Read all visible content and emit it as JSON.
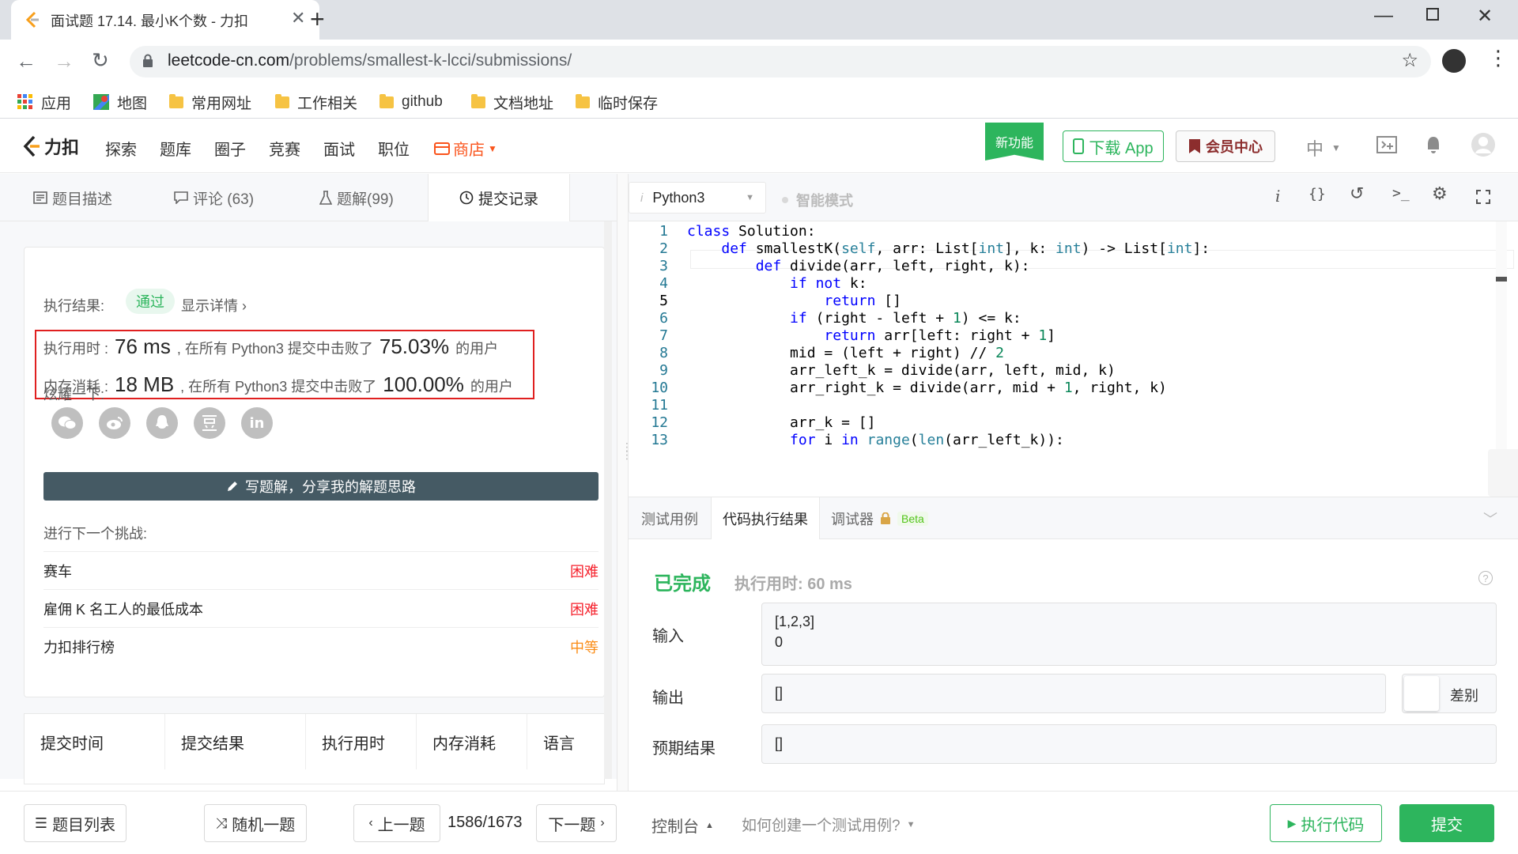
{
  "browser": {
    "tab_title": "面试题 17.14. 最小K个数 - 力扣",
    "url_host": "leetcode-cn.com",
    "url_path": "/problems/smallest-k-lcci/submissions/",
    "bookmarks": [
      "应用",
      "地图",
      "常用网址",
      "工作相关",
      "github",
      "文档地址",
      "临时保存"
    ]
  },
  "site": {
    "logo_text": "力扣",
    "nav": [
      "探索",
      "题库",
      "圈子",
      "竞赛",
      "面试",
      "职位"
    ],
    "store_label": "商店",
    "new_feature": "新功能",
    "download_app": "下载 App",
    "member_center": "会员中心",
    "lang": "中"
  },
  "left_tabs": [
    "题目描述",
    "评论 (63)",
    "题解(99)",
    "提交记录"
  ],
  "result": {
    "label": "执行结果:",
    "status": "通过",
    "details_link": "显示详情 ›",
    "time_label": "执行用时 :",
    "time_value": "76 ms",
    "time_text": ", 在所有 Python3 提交中击败了",
    "time_percent": "75.03%",
    "time_suffix": "的用户",
    "mem_label": "内存消耗 :",
    "mem_value": "18 MB",
    "mem_text": ", 在所有 Python3 提交中击败了",
    "mem_percent": "100.00%",
    "mem_suffix": "的用户",
    "share_label": "炫耀一下:",
    "share_icons": [
      "wechat-icon",
      "weibo-icon",
      "qq-icon",
      "douban-icon",
      "linkedin-icon"
    ],
    "write_solution": "写题解，分享我的解题思路",
    "next_label": "进行下一个挑战:",
    "challenges": [
      {
        "name": "赛车",
        "level": "困难"
      },
      {
        "name": "雇佣 K 名工人的最低成本",
        "level": "困难"
      },
      {
        "name": "力扣排行榜",
        "level": "中等"
      }
    ]
  },
  "submissions_table": {
    "headers": [
      "提交时间",
      "提交结果",
      "执行用时",
      "内存消耗",
      "语言"
    ]
  },
  "editor": {
    "language": "Python3",
    "mode": "智能模式",
    "lines": [
      "class Solution:",
      "    def smallestK(self, arr: List[int], k: int) -> List[int]:",
      "        def divide(arr, left, right, k):",
      "            if not k:",
      "                return []",
      "            if (right - left + 1) <= k:",
      "                return arr[left: right + 1]",
      "            mid = (left + right) // 2",
      "            arr_left_k = divide(arr, left, mid, k)",
      "            arr_right_k = divide(arr, mid + 1, right, k)",
      "",
      "            arr_k = []",
      "            for i in range(len(arr_left_k)):"
    ]
  },
  "result_tabs": {
    "testcase": "测试用例",
    "exec_result": "代码执行结果",
    "debugger": "调试器",
    "beta": "Beta"
  },
  "exec": {
    "status": "已完成",
    "time": "执行用时: 60 ms",
    "input_label": "输入",
    "input_lines": [
      "[1,2,3]",
      "0"
    ],
    "output_label": "输出",
    "output_value": "[]",
    "diff_label": "差别",
    "expected_label": "预期结果",
    "expected_value": "[]"
  },
  "bottom": {
    "problem_list": "题目列表",
    "random": "随机一题",
    "prev": "上一题",
    "counter": "1586/1673",
    "next": "下一题",
    "console": "控制台",
    "how_to": "如何创建一个测试用例?",
    "run": "执行代码",
    "submit": "提交"
  }
}
